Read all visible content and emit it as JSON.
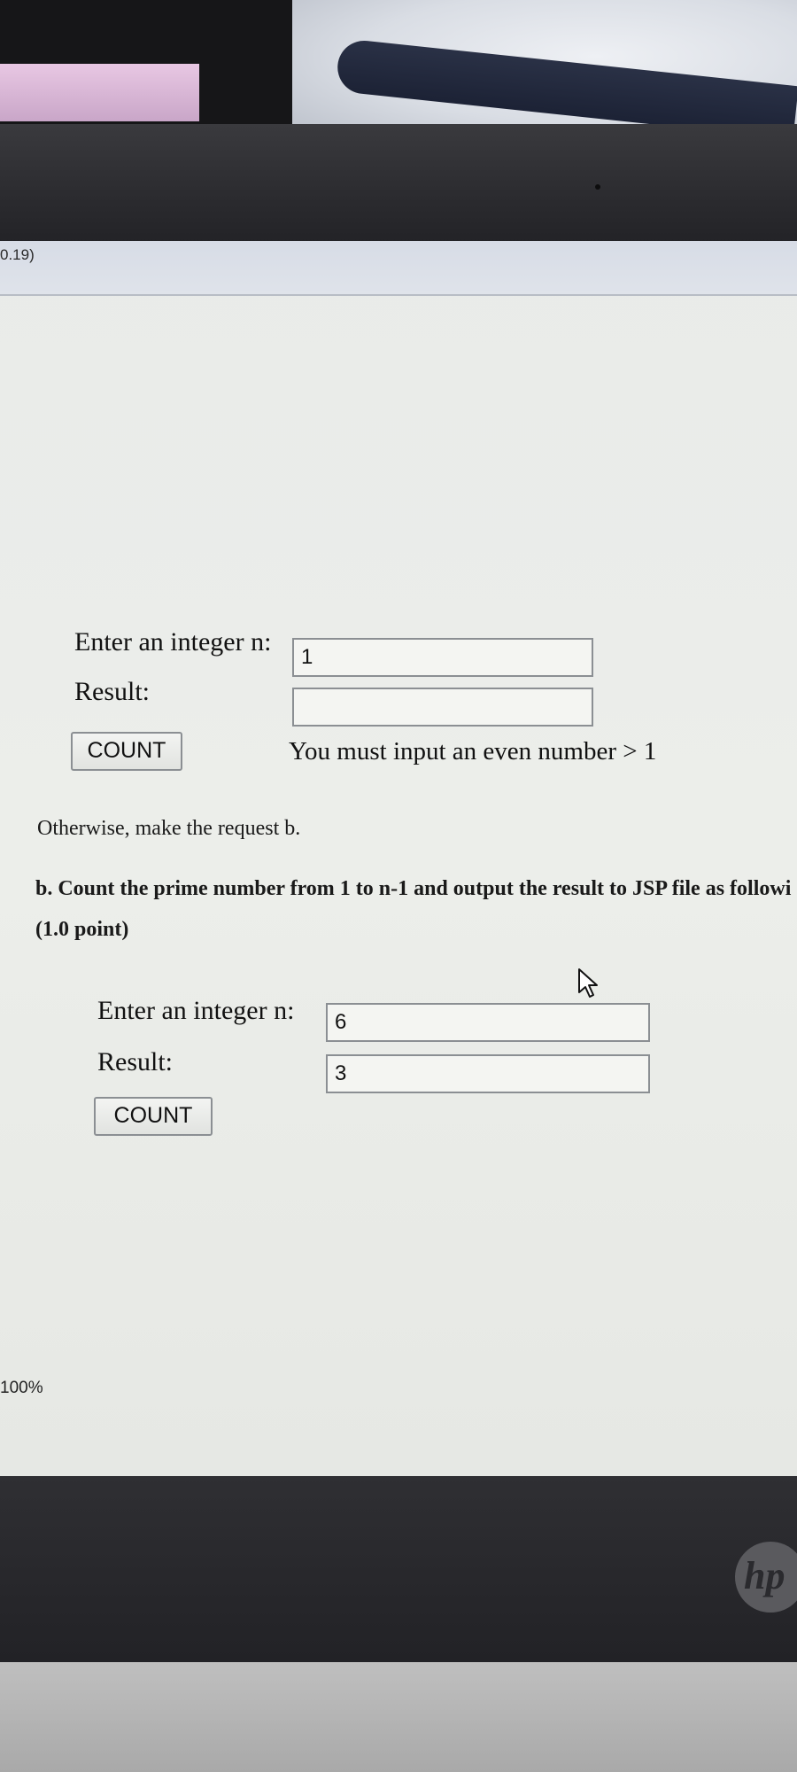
{
  "browser": {
    "title_fragment": "0.19)",
    "zoom_label": "100%"
  },
  "example_a": {
    "label_n": "Enter an integer n:",
    "value_n": "1",
    "label_result": "Result:",
    "value_result": "",
    "button_label": "COUNT",
    "error_message": "You must input an even number > 1"
  },
  "instructions": {
    "otherwise_text": "Otherwise, make the request b.",
    "part_b_text": "b. Count the prime number from 1 to n-1 and output the result to JSP file as followi",
    "points_text": "(1.0 point)"
  },
  "example_b": {
    "label_n": "Enter an integer n:",
    "value_n": "6",
    "label_result": "Result:",
    "value_result": "3",
    "button_label": "COUNT"
  },
  "device": {
    "logo_text": "hp"
  },
  "icons": {
    "cursor": "mouse-pointer-icon"
  }
}
